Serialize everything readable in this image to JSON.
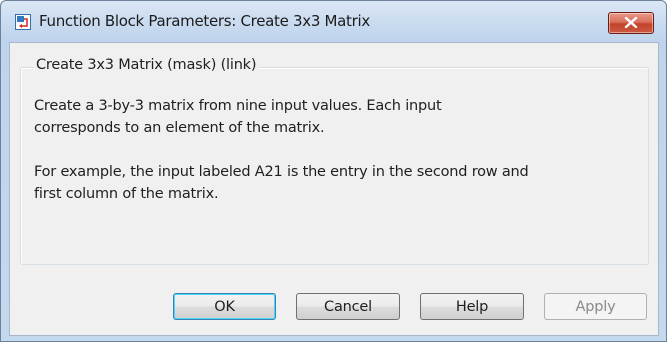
{
  "window": {
    "title": "Function Block Parameters: Create 3x3 Matrix",
    "app_icon": "simulink-block-icon",
    "close_icon": "close-icon"
  },
  "group": {
    "title": "Create 3x3 Matrix (mask) (link)",
    "paragraph_1": [
      "Create a 3-by-3 matrix from nine input values. Each input",
      "corresponds to an element of the matrix."
    ],
    "paragraph_2": [
      "For example, the input labeled A21 is the entry in the second row and",
      "first column of the matrix."
    ]
  },
  "buttons": {
    "ok": "OK",
    "cancel": "Cancel",
    "help": "Help",
    "apply": "Apply"
  },
  "colors": {
    "close_button": "#c4432b",
    "default_button_border": "#3c7fb1",
    "dialog_face": "#f0f0f0"
  }
}
